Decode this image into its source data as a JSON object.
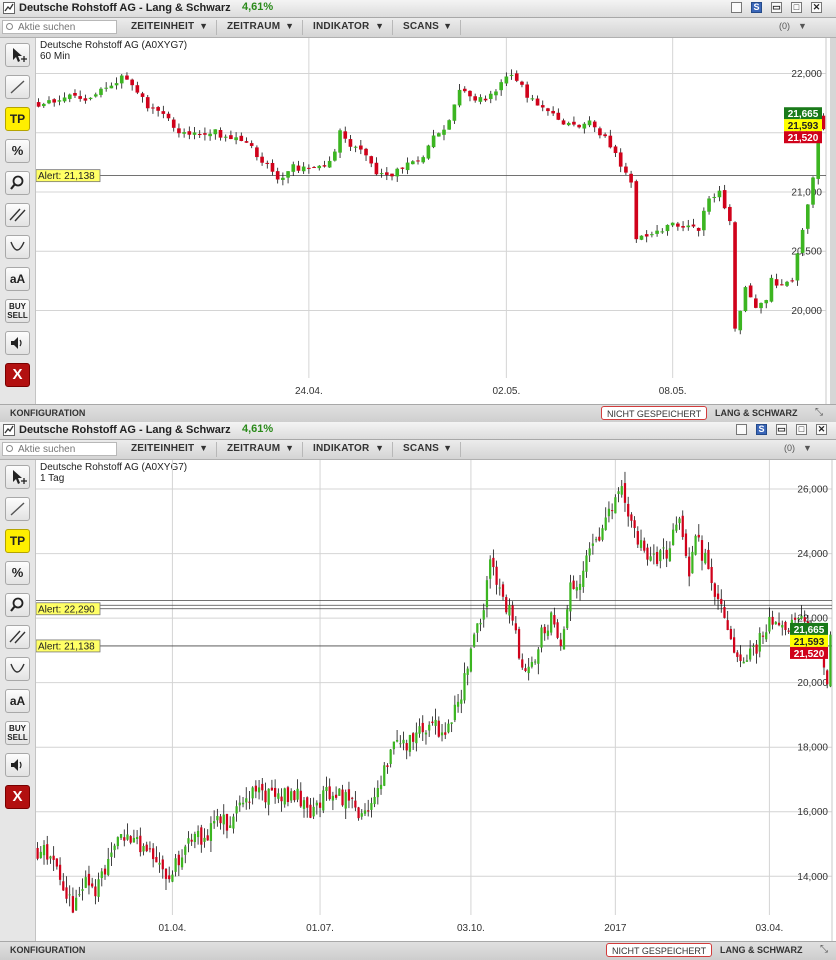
{
  "panels": [
    {
      "window": {
        "title": "Deutsche Rohstoff AG - Lang & Schwarz",
        "change": "4,61%"
      },
      "toolbar": {
        "search_placeholder": "Aktie suchen",
        "menus": [
          "ZEITEINHEIT",
          "ZEITRAUM",
          "INDIKATOR",
          "SCANS"
        ],
        "count": "(0)"
      },
      "tools": [
        "cursor-tool",
        "line-tool",
        "TP",
        "%",
        "zoom-tool",
        "parallel-tool",
        "arc-tool",
        "aA",
        "BUY SELL",
        "sound-tool",
        "X"
      ],
      "status": {
        "config": "KONFIGURATION",
        "unsaved": "NICHT GESPEICHERT",
        "broker": "LANG & SCHWARZ"
      }
    },
    {
      "window": {
        "title": "Deutsche Rohstoff AG - Lang & Schwarz",
        "change": "4,61%"
      },
      "toolbar": {
        "search_placeholder": "Aktie suchen",
        "menus": [
          "ZEITEINHEIT",
          "ZEITRAUM",
          "INDIKATOR",
          "SCANS"
        ],
        "count": "(0)"
      },
      "tools": [
        "cursor-tool",
        "line-tool",
        "TP",
        "%",
        "zoom-tool",
        "parallel-tool",
        "arc-tool",
        "aA",
        "BUY SELL",
        "sound-tool",
        "X"
      ],
      "status": {
        "config": "KONFIGURATION",
        "unsaved": "NICHT GESPEICHERT",
        "broker": "LANG & SCHWARZ"
      }
    }
  ],
  "colors": {
    "up": "#3cb521",
    "down": "#d0021b",
    "grid": "#d4d4d4",
    "alert_bg": "#ffff66",
    "last_bg": "#1a7a1a",
    "mid_bg": "#ffff00",
    "bid_bg": "#d0021b"
  },
  "chart_data": [
    {
      "type": "candlestick",
      "title": "Deutsche Rohstoff AG (A0XYG7)",
      "subtitle": "60 Min",
      "xticks": [
        "24.04.",
        "02.05.",
        "08.05."
      ],
      "xtick_index": [
        52,
        90,
        122
      ],
      "n_candles": 152,
      "yticks": [
        "22,000",
        "21,500",
        "21,000",
        "20,500",
        "20,000"
      ],
      "ytick_values": [
        22.0,
        21.5,
        21.0,
        20.5,
        20.0
      ],
      "ylim": [
        19.43,
        22.3
      ],
      "price_labels": [
        "21,665",
        "21,593",
        "21,520"
      ],
      "price_values": [
        21.665,
        21.593,
        21.52
      ],
      "alerts": [
        {
          "label": "Alert: 21,138",
          "value": 21.138
        }
      ],
      "path": [
        [
          0,
          21.75
        ],
        [
          6,
          21.8
        ],
        [
          10,
          21.78
        ],
        [
          14,
          21.93
        ],
        [
          17,
          21.98
        ],
        [
          20,
          21.78
        ],
        [
          22,
          21.7
        ],
        [
          25,
          21.62
        ],
        [
          28,
          21.48
        ],
        [
          31,
          21.52
        ],
        [
          34,
          21.5
        ],
        [
          37,
          21.45
        ],
        [
          40,
          21.4
        ],
        [
          44,
          21.22
        ],
        [
          46,
          21.08
        ],
        [
          49,
          21.2
        ],
        [
          52,
          21.2
        ],
        [
          56,
          21.23
        ],
        [
          58,
          21.5
        ],
        [
          60,
          21.4
        ],
        [
          63,
          21.3
        ],
        [
          65,
          21.18
        ],
        [
          67,
          21.15
        ],
        [
          70,
          21.2
        ],
        [
          73,
          21.25
        ],
        [
          76,
          21.45
        ],
        [
          79,
          21.6
        ],
        [
          81,
          21.85
        ],
        [
          84,
          21.78
        ],
        [
          87,
          21.8
        ],
        [
          89,
          21.9
        ],
        [
          91,
          21.98
        ],
        [
          94,
          21.82
        ],
        [
          97,
          21.72
        ],
        [
          99,
          21.65
        ],
        [
          101,
          21.6
        ],
        [
          104,
          21.55
        ],
        [
          106,
          21.58
        ],
        [
          108,
          21.5
        ],
        [
          110,
          21.4
        ],
        [
          112,
          21.2
        ],
        [
          114,
          21.1
        ],
        [
          115,
          20.6
        ],
        [
          117,
          20.62
        ],
        [
          119,
          20.65
        ],
        [
          121,
          20.75
        ],
        [
          123,
          20.68
        ],
        [
          125,
          20.72
        ],
        [
          127,
          20.7
        ],
        [
          129,
          20.95
        ],
        [
          131,
          20.98
        ],
        [
          133,
          20.78
        ],
        [
          134,
          19.85
        ],
        [
          136,
          20.2
        ],
        [
          138,
          20.05
        ],
        [
          140,
          20.08
        ],
        [
          141,
          20.25
        ],
        [
          143,
          20.22
        ],
        [
          145,
          20.28
        ],
        [
          147,
          20.65
        ],
        [
          149,
          21.1
        ],
        [
          150,
          21.68
        ],
        [
          151,
          21.52
        ]
      ]
    },
    {
      "type": "candlestick",
      "title": "Deutsche Rohstoff AG (A0XYG7)",
      "subtitle": "1 Tag",
      "xticks": [
        "01.04.",
        "01.07.",
        "03.10.",
        "2017",
        "03.04."
      ],
      "xtick_index": [
        42,
        88,
        135,
        180,
        228
      ],
      "n_candles": 248,
      "yticks": [
        "26,000",
        "24,000",
        "22,000",
        "20,000",
        "18,000",
        "16,000",
        "14,000"
      ],
      "ytick_values": [
        26.0,
        24.0,
        22.0,
        20.0,
        18.0,
        16.0,
        14.0
      ],
      "ylim": [
        12.8,
        26.9
      ],
      "price_labels": [
        "21,665",
        "21,593",
        "21,520"
      ],
      "price_values": [
        21.665,
        21.593,
        21.52
      ],
      "alerts": [
        {
          "label": "Alert: 22,290",
          "value": 22.29
        },
        {
          "label": "Alert: 21,138",
          "value": 21.138
        }
      ],
      "alert_lines": [
        22.545,
        22.4,
        22.29,
        21.138
      ],
      "path": [
        [
          0,
          14.8
        ],
        [
          4,
          14.7
        ],
        [
          8,
          13.8
        ],
        [
          11,
          13.1
        ],
        [
          13,
          13.5
        ],
        [
          15,
          13.9
        ],
        [
          18,
          13.6
        ],
        [
          21,
          14.2
        ],
        [
          25,
          15.1
        ],
        [
          29,
          15.0
        ],
        [
          33,
          14.9
        ],
        [
          36,
          14.7
        ],
        [
          41,
          14.0
        ],
        [
          44,
          14.5
        ],
        [
          48,
          15.2
        ],
        [
          52,
          15.1
        ],
        [
          56,
          15.8
        ],
        [
          60,
          15.6
        ],
        [
          64,
          16.3
        ],
        [
          68,
          16.7
        ],
        [
          72,
          16.5
        ],
        [
          76,
          16.4
        ],
        [
          80,
          16.6
        ],
        [
          83,
          16.2
        ],
        [
          86,
          16.0
        ],
        [
          90,
          16.6
        ],
        [
          94,
          16.5
        ],
        [
          98,
          16.2
        ],
        [
          102,
          15.9
        ],
        [
          105,
          16.4
        ],
        [
          110,
          17.9
        ],
        [
          115,
          18.1
        ],
        [
          118,
          18.3
        ],
        [
          122,
          18.8
        ],
        [
          126,
          18.5
        ],
        [
          131,
          19.2
        ],
        [
          135,
          21.0
        ],
        [
          139,
          22.5
        ],
        [
          141,
          24.0
        ],
        [
          143,
          23.2
        ],
        [
          145,
          22.6
        ],
        [
          148,
          22.0
        ],
        [
          151,
          20.3
        ],
        [
          154,
          20.4
        ],
        [
          157,
          21.5
        ],
        [
          160,
          22.0
        ],
        [
          163,
          21.3
        ],
        [
          166,
          23.0
        ],
        [
          169,
          23.3
        ],
        [
          172,
          24.0
        ],
        [
          175,
          24.6
        ],
        [
          178,
          25.2
        ],
        [
          181,
          26.1
        ],
        [
          183,
          25.8
        ],
        [
          185,
          24.9
        ],
        [
          187,
          24.4
        ],
        [
          190,
          24.0
        ],
        [
          193,
          23.9
        ],
        [
          196,
          24.0
        ],
        [
          200,
          25.0
        ],
        [
          203,
          23.5
        ],
        [
          205,
          24.5
        ],
        [
          208,
          23.8
        ],
        [
          210,
          23.2
        ],
        [
          213,
          22.2
        ],
        [
          216,
          21.3
        ],
        [
          220,
          20.7
        ],
        [
          223,
          21.0
        ],
        [
          226,
          21.5
        ],
        [
          229,
          22.0
        ],
        [
          232,
          21.6
        ],
        [
          235,
          21.9
        ],
        [
          238,
          22.0
        ],
        [
          241,
          21.5
        ],
        [
          244,
          21.0
        ],
        [
          246,
          20.1
        ],
        [
          247,
          21.55
        ]
      ]
    }
  ]
}
